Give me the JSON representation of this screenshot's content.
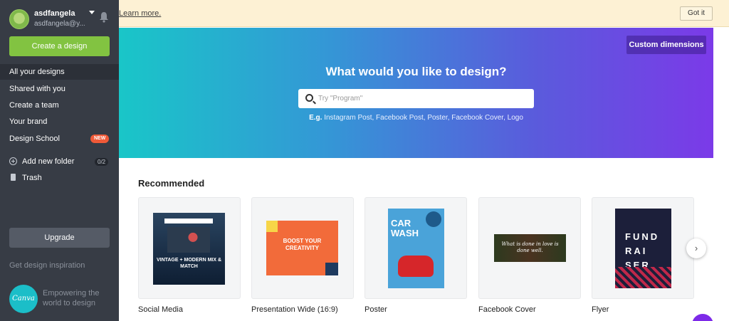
{
  "user": {
    "name": "asdfangela",
    "email": "asdfangela@y..."
  },
  "sidebar": {
    "create_label": "Create a design",
    "items": [
      {
        "label": "All your designs"
      },
      {
        "label": "Shared with you"
      },
      {
        "label": "Create a team"
      },
      {
        "label": "Your brand"
      },
      {
        "label": "Design School",
        "badge": "NEW"
      }
    ],
    "add_folder": "Add new folder",
    "folder_count": "0/2",
    "trash": "Trash",
    "upgrade": "Upgrade",
    "inspiration": "Get design inspiration",
    "logo_text": "Canva",
    "tagline": "Empowering the world to design"
  },
  "banner": {
    "learn_more": "Learn more.",
    "got_it": "Got it"
  },
  "hero": {
    "custom_dimensions": "Custom dimensions",
    "title": "What would you like to design?",
    "search_placeholder": "Try \"Program\"",
    "eg_label": "E.g.",
    "examples": [
      "Instagram Post",
      "Facebook Post",
      "Poster",
      "Facebook Cover",
      "Logo"
    ]
  },
  "recommended": {
    "title": "Recommended",
    "cards": [
      {
        "label": "Social Media",
        "thumb_text": "VINTAGE + MODERN MIX & MATCH"
      },
      {
        "label": "Presentation Wide (16:9)",
        "thumb_text": "BOOST YOUR CREATIVITY"
      },
      {
        "label": "Poster",
        "thumb_text": "CAR WASH"
      },
      {
        "label": "Facebook Cover",
        "thumb_text": "What is done in love is done well."
      },
      {
        "label": "Flyer",
        "thumb_text": "FUND RAI SER"
      }
    ]
  },
  "colors": {
    "accent_green": "#82c341",
    "sidebar_bg": "#373c45",
    "new_badge": "#f05a38",
    "brand_purple": "#7d2ae8"
  }
}
